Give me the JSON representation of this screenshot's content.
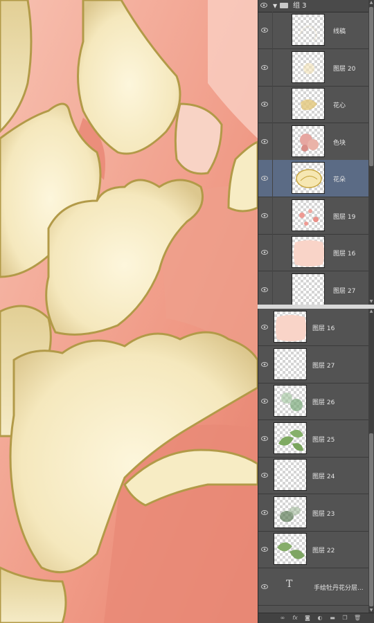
{
  "colors": {
    "canvas_bg": "#f6b6a6",
    "petal_fill": "#f7ecc4",
    "petal_shade": "#d8c28a",
    "outline": "#b29a48",
    "panel_bg": "#535353",
    "selected_row": "#5b6b85",
    "pink_wash": "#ea8f7c"
  },
  "layers_top": {
    "group_name": "组 3",
    "rows": [
      {
        "name": "线稿",
        "thumb": "lineart"
      },
      {
        "name": "图层 20",
        "thumb": "faint"
      },
      {
        "name": "花心",
        "thumb": "center"
      },
      {
        "name": "色块",
        "thumb": "blocks"
      },
      {
        "name": "花朵",
        "thumb": "flower",
        "selected": true
      },
      {
        "name": "图层 19",
        "thumb": "pinkdots"
      },
      {
        "name": "图层 16",
        "thumb": "pinkblob"
      },
      {
        "name": "图层 27",
        "thumb": "empty"
      }
    ]
  },
  "layers_bottom": {
    "rows": [
      {
        "name": "图层 16",
        "thumb": "pinkblob"
      },
      {
        "name": "图层 27",
        "thumb": "empty"
      },
      {
        "name": "图层 26",
        "thumb": "greenfade"
      },
      {
        "name": "图层 25",
        "thumb": "leaves"
      },
      {
        "name": "图层 24",
        "thumb": "empty"
      },
      {
        "name": "图层 23",
        "thumb": "greensmudge"
      },
      {
        "name": "图层 22",
        "thumb": "leaves2"
      },
      {
        "name": "手绘牡丹花分层...",
        "thumb": "text"
      }
    ]
  },
  "icons": {
    "eye": "visibility-eye-icon",
    "folder": "folder-icon",
    "text_layer": "T"
  },
  "footer_icons": [
    "link-icon",
    "fx-icon",
    "mask-icon",
    "adjustment-icon",
    "folder-icon",
    "new-layer-icon",
    "trash-icon"
  ]
}
